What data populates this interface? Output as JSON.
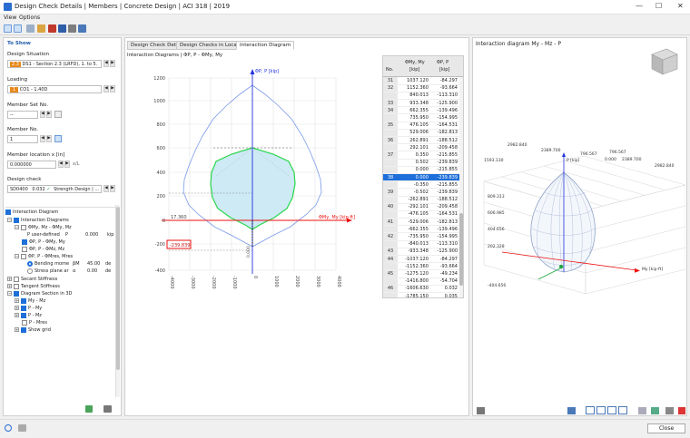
{
  "window": {
    "title": "Design Check Details | Members | Concrete Design | ACI 318 | 2019",
    "min": "—",
    "max": "☐",
    "close": "✕"
  },
  "menu": {
    "view": "View",
    "options": "Options"
  },
  "left": {
    "to_show": "To Show",
    "design_situation_label": "Design Situation",
    "ds_badge": "2.3",
    "ds_value": "DS1 - Section 2.3 (LRFD), 1. to 5.",
    "loading_label": "Loading",
    "load_badge": "1",
    "load_value": "CO1 - 1.40D",
    "member_set_label": "Member Set No.",
    "member_set_value": "--",
    "member_no_label": "Member No.",
    "member_no_value": "1",
    "location_label": "Member location x [in]",
    "location_value": "0.000000",
    "location_unit": "x/L",
    "design_check_label": "Design check",
    "dc_code": "SD0400",
    "dc_ratio": "0.032",
    "dc_check": "✓",
    "dc_desc": "Strength Design | ..."
  },
  "tree": {
    "interaction_diagram": "Interaction Diagram",
    "interaction_diagrams": "Interaction Diagrams",
    "mymz": "ΦMy, Mz - ΦMy, Mz",
    "puser": "P user-defined",
    "puser_sym": "P",
    "puser_val": "0.000",
    "puser_unit": "kip",
    "pmy": "ΦP, P - ΦMy, My",
    "pmz": "ΦP, P - ΦMz, Mz",
    "pmres": "ΦP, P - ΦMres, Mres",
    "bending": "Bending mome",
    "bending_sym": "βM",
    "bending_val": "45.00",
    "bending_unit": "de",
    "stress": "Stress plane ar",
    "stress_sym": "α",
    "stress_val": "0.00",
    "stress_unit": "de",
    "secant": "Secant Stiffness",
    "tangent": "Tangent Stiffness",
    "diagram3d": "Diagram Section in 3D",
    "my_mz": "My - Mz",
    "p_my": "P - My",
    "p_mz": "P - Mz",
    "p_mres": "P - Mres",
    "show_grid": "Show grid"
  },
  "center": {
    "tabs": [
      "Design Check Details",
      "Design Checks in Location",
      "Interaction Diagram"
    ],
    "diagram_title": "Interaction Diagrams | ΦP, P - ΦMy, My",
    "p_axis_label": "ΦP, P [kip]",
    "m_axis_label": "ΦMy, My [kip-ft]",
    "y_ticks": [
      "1200",
      "1000",
      "800",
      "600",
      "400",
      "200",
      "0",
      "-200",
      "-400"
    ],
    "x_ticks": [
      "-4000",
      "-3000",
      "-2000",
      "-1000",
      "0",
      "1000",
      "2000",
      "3000",
      "4000"
    ],
    "annot_top": "17.360",
    "annot_bottom": "-239.839",
    "annot_vertical": "0.000",
    "table": {
      "col_no": "No.",
      "col_m": "ΦMy, My",
      "col_m_unit": "[kip]",
      "col_p": "ΦP, P",
      "col_p_unit": "[kip]",
      "rows": [
        [
          "31",
          "1037.120",
          "-84.297"
        ],
        [
          "32",
          "1152.360",
          "-93.664"
        ],
        [
          "",
          "840.013",
          "-113.310"
        ],
        [
          "33",
          "933.348",
          "-125.900"
        ],
        [
          "34",
          "662.355",
          "-139.496"
        ],
        [
          "",
          "735.950",
          "-154.995"
        ],
        [
          "35",
          "476.105",
          "-164.531"
        ],
        [
          "",
          "529.006",
          "-182.813"
        ],
        [
          "36",
          "262.891",
          "-188.512"
        ],
        [
          "",
          "292.101",
          "-209.458"
        ],
        [
          "37",
          "0.350",
          "-215.855"
        ],
        [
          "",
          "0.502",
          "-239.839"
        ],
        [
          "",
          "0.000",
          "-215.855"
        ],
        [
          "38",
          "0.000",
          "-239.839"
        ],
        [
          "",
          "-0.350",
          "-215.855"
        ],
        [
          "39",
          "-0.502",
          "-239.839"
        ],
        [
          "",
          "-262.891",
          "-188.512"
        ],
        [
          "40",
          "-292.101",
          "-209.458"
        ],
        [
          "",
          "-476.105",
          "-164.531"
        ],
        [
          "41",
          "-529.006",
          "-182.813"
        ],
        [
          "",
          "-662.355",
          "-139.496"
        ],
        [
          "42",
          "-735.950",
          "-154.995"
        ],
        [
          "",
          "-840.013",
          "-113.310"
        ],
        [
          "43",
          "-933.348",
          "-125.900"
        ],
        [
          "44",
          "-1037.120",
          "-84.297"
        ],
        [
          "",
          "-1152.360",
          "-93.664"
        ],
        [
          "45",
          "-1275.120",
          "-49.234"
        ],
        [
          "",
          "-1416.800",
          "-54.704"
        ],
        [
          "46",
          "-1606.630",
          "0.032"
        ],
        [
          "",
          "-1785.150",
          "0.035"
        ]
      ]
    }
  },
  "right": {
    "title": "Interaction diagram My - Mz - P",
    "top_labels": [
      "2982.840",
      "2389.700",
      "796.567",
      "0.000",
      "796.567",
      "2389.700",
      "2982.840",
      "1593.130"
    ],
    "p_label": "P [kip]",
    "my_label": "My [kip-ft]",
    "v_ticks": [
      "809.313",
      "606.985",
      "404.656",
      "202.328",
      "-404.656"
    ]
  },
  "footer": {
    "close": "Close"
  }
}
